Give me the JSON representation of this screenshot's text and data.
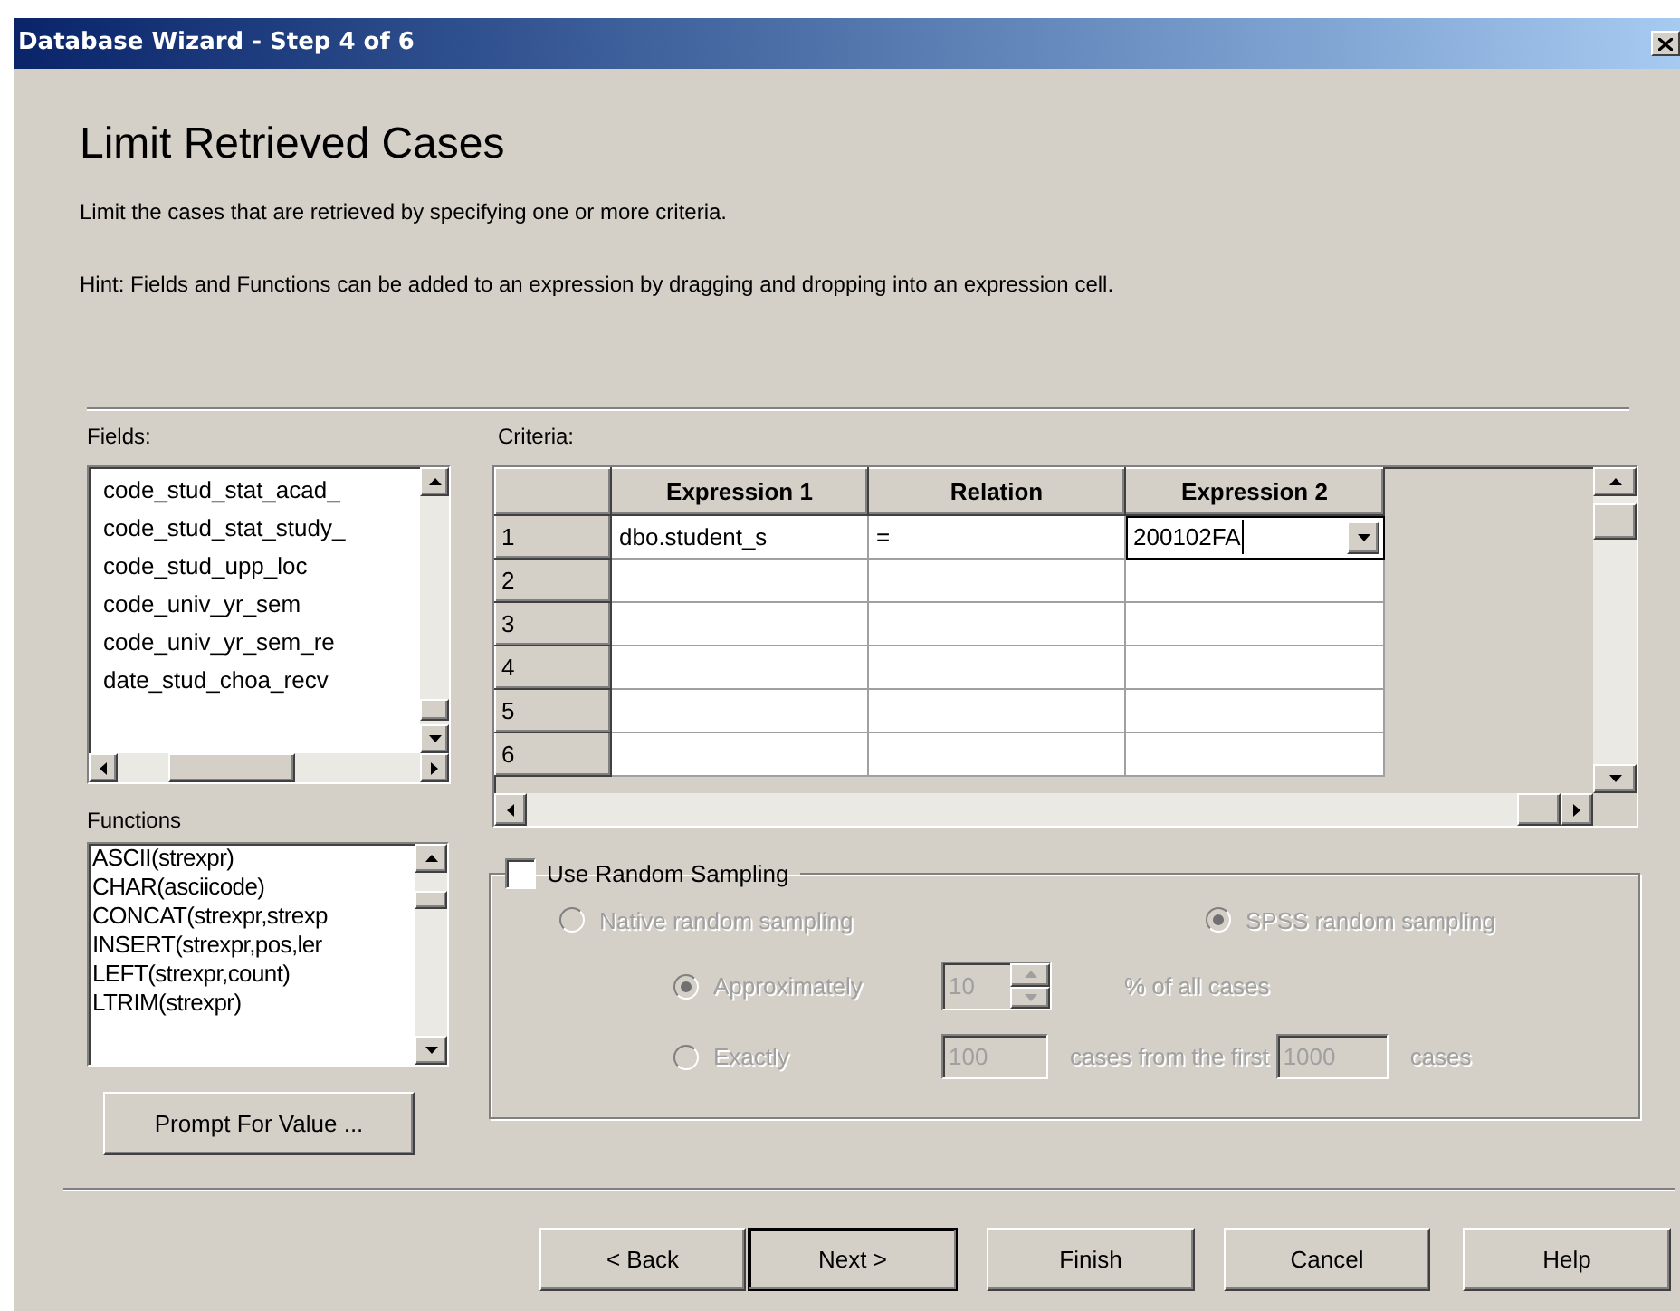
{
  "window": {
    "title": "Database Wizard - Step 4 of 6"
  },
  "heading": "Limit Retrieved Cases",
  "description": "Limit the cases that are retrieved by specifying one or more criteria.",
  "hint": "Hint: Fields and Functions can be added to an expression by dragging and dropping into an expression cell.",
  "fields": {
    "label": "Fields:",
    "items": [
      "code_stud_stat_acad_",
      "code_stud_stat_study_",
      "code_stud_upp_loc",
      "code_univ_yr_sem",
      "code_univ_yr_sem_re",
      "date_stud_choa_recv"
    ]
  },
  "functions": {
    "label": "Functions",
    "items": [
      "ASCII(strexpr)",
      "CHAR(asciicode)",
      "CONCAT(strexpr,strexp",
      "INSERT(strexpr,pos,ler",
      "LEFT(strexpr,count)",
      "LTRIM(strexpr)"
    ]
  },
  "prompt_button": "Prompt For Value ...",
  "criteria": {
    "label": "Criteria:",
    "columns": [
      "Expression 1",
      "Relation",
      "Expression 2"
    ],
    "rows": [
      {
        "number": "1",
        "cells": [
          {
            "text": "dbo.student_s"
          },
          {
            "text": "="
          },
          {
            "text": "200102FA",
            "editing": true
          }
        ]
      },
      {
        "number": "2"
      },
      {
        "number": "3"
      },
      {
        "number": "4"
      },
      {
        "number": "5"
      },
      {
        "number": "6"
      }
    ]
  },
  "random_sampling": {
    "label": "Use Random Sampling",
    "checked": false,
    "options_disabled": true,
    "methods": [
      {
        "label": "Native random sampling",
        "selected": false
      },
      {
        "label": "SPSS random sampling",
        "selected": true
      }
    ],
    "approximately": {
      "label": "Approximately",
      "selected": true,
      "value": "10",
      "suffix": "% of all cases"
    },
    "exactly": {
      "label": "Exactly",
      "selected": false,
      "value": "100",
      "middle": "cases from the first",
      "total": "1000",
      "suffix": "cases"
    }
  },
  "buttons": [
    {
      "label": "< Back",
      "default": false
    },
    {
      "label": "Next >",
      "default": true
    },
    {
      "label": "Finish",
      "default": false
    },
    {
      "label": "Cancel",
      "default": false
    },
    {
      "label": "Help",
      "default": false
    }
  ]
}
